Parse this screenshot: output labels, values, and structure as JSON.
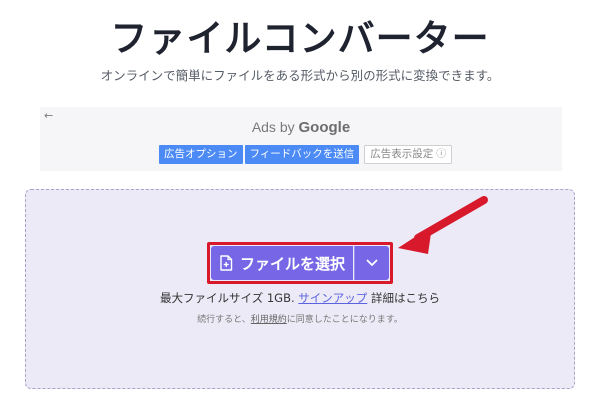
{
  "header": {
    "title": "ファイルコンバーター",
    "subtitle": "オンラインで簡単にファイルをある形式から別の形式に変換できます。"
  },
  "ad": {
    "back_glyph": "←",
    "ads_by": "Ads by",
    "brand": "Google",
    "buttons": [
      "広告オプション",
      "フィードバックを送信"
    ],
    "settings_label": "広告表示設定",
    "settings_icon": "ⓘ"
  },
  "uploader": {
    "choose_label": "ファイルを選択",
    "file_icon": "file-plus-icon",
    "dropdown_icon": "chevron-down-icon",
    "max_size_text": "最大ファイルサイズ 1GB.",
    "signup_link": "サインアップ",
    "details_text": "詳細はこちら",
    "terms_prefix": "続行すると、",
    "terms_link": "利用規約",
    "terms_suffix": "に同意したことになります。"
  },
  "colors": {
    "accent": "#7767e6",
    "drop_zone_bg": "#eceaf6",
    "ad_button": "#4c8bf5",
    "highlight": "#d8182b"
  }
}
